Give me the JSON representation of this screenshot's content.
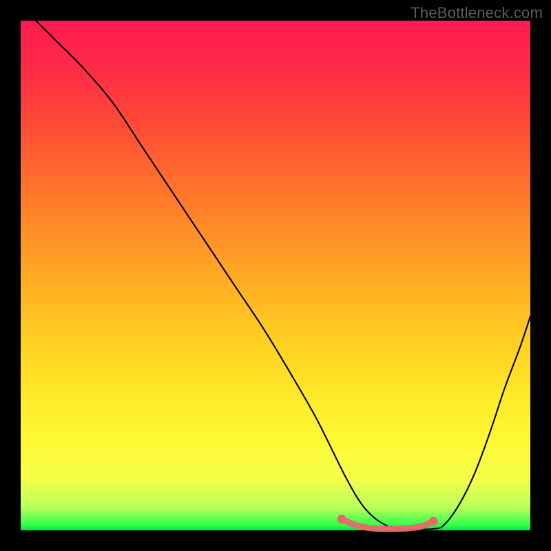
{
  "watermark": "TheBottleneck.com",
  "gradient_stops": [
    {
      "offset": 0.0,
      "color": "#ff1a52"
    },
    {
      "offset": 0.1,
      "color": "#ff2b46"
    },
    {
      "offset": 0.22,
      "color": "#ff5034"
    },
    {
      "offset": 0.35,
      "color": "#ff7a2a"
    },
    {
      "offset": 0.48,
      "color": "#ffa324"
    },
    {
      "offset": 0.6,
      "color": "#ffc821"
    },
    {
      "offset": 0.72,
      "color": "#ffe627"
    },
    {
      "offset": 0.82,
      "color": "#fff833"
    },
    {
      "offset": 0.9,
      "color": "#f4ff4a"
    },
    {
      "offset": 0.955,
      "color": "#b9ff5a"
    },
    {
      "offset": 0.99,
      "color": "#2fff4a"
    },
    {
      "offset": 1.0,
      "color": "#00e63a"
    }
  ],
  "chart_data": {
    "type": "line",
    "title": "",
    "xlabel": "",
    "ylabel": "",
    "xlim": [
      0,
      100
    ],
    "ylim": [
      0,
      100
    ],
    "grid": false,
    "series": [
      {
        "name": "bottleneck-curve",
        "x": [
          3,
          7,
          12,
          18,
          24,
          30,
          36,
          42,
          48,
          54,
          58,
          61,
          64,
          67,
          70,
          73,
          76,
          79,
          81,
          83,
          86,
          89,
          92,
          95,
          98,
          100
        ],
        "y": [
          100,
          96,
          91,
          84,
          75,
          66,
          57,
          48,
          39,
          29,
          22,
          16,
          10,
          5,
          2,
          0.5,
          0.2,
          0.2,
          0.3,
          1,
          5,
          11,
          19,
          28,
          36,
          42
        ]
      }
    ],
    "highlight": {
      "name": "valley-highlight",
      "color": "#e86a6a",
      "x": [
        63,
        65,
        67,
        69,
        71,
        73,
        75,
        77,
        79,
        81
      ],
      "y": [
        2.2,
        1.3,
        0.7,
        0.4,
        0.3,
        0.3,
        0.35,
        0.5,
        0.9,
        1.8
      ]
    }
  }
}
